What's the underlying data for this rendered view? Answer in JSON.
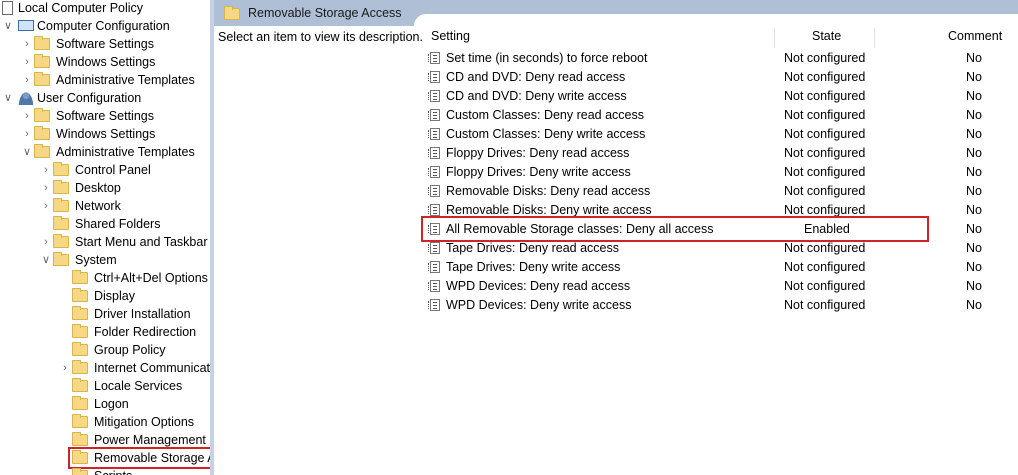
{
  "tree": [
    {
      "label": "Local Computer Policy",
      "chev": "",
      "icon": "policy-computer-icon",
      "level": 0
    },
    {
      "label": "Computer Configuration",
      "chev": "v",
      "icon": "computer-icon",
      "level": 1
    },
    {
      "label": "Software Settings",
      "chev": ">",
      "icon": "folder-icon",
      "level": 2
    },
    {
      "label": "Windows Settings",
      "chev": ">",
      "icon": "folder-icon",
      "level": 2
    },
    {
      "label": "Administrative Templates",
      "chev": ">",
      "icon": "folder-icon",
      "level": 2
    },
    {
      "label": "User Configuration",
      "chev": "v",
      "icon": "user-icon",
      "level": 1
    },
    {
      "label": "Software Settings",
      "chev": ">",
      "icon": "folder-icon",
      "level": 2
    },
    {
      "label": "Windows Settings",
      "chev": ">",
      "icon": "folder-icon",
      "level": 2
    },
    {
      "label": "Administrative Templates",
      "chev": "v",
      "icon": "folder-icon",
      "level": 2
    },
    {
      "label": "Control Panel",
      "chev": ">",
      "icon": "folder-icon",
      "level": 3
    },
    {
      "label": "Desktop",
      "chev": ">",
      "icon": "folder-icon",
      "level": 3
    },
    {
      "label": "Network",
      "chev": ">",
      "icon": "folder-icon",
      "level": 3
    },
    {
      "label": "Shared Folders",
      "chev": "",
      "icon": "folder-icon",
      "level": 3
    },
    {
      "label": "Start Menu and Taskbar",
      "chev": ">",
      "icon": "folder-icon",
      "level": 3
    },
    {
      "label": "System",
      "chev": "v",
      "icon": "folder-icon",
      "level": 3
    },
    {
      "label": "Ctrl+Alt+Del Options",
      "chev": "",
      "icon": "folder-icon",
      "level": 4
    },
    {
      "label": "Display",
      "chev": "",
      "icon": "folder-icon",
      "level": 4
    },
    {
      "label": "Driver Installation",
      "chev": "",
      "icon": "folder-icon",
      "level": 4
    },
    {
      "label": "Folder Redirection",
      "chev": "",
      "icon": "folder-icon",
      "level": 4
    },
    {
      "label": "Group Policy",
      "chev": "",
      "icon": "folder-icon",
      "level": 4
    },
    {
      "label": "Internet Communicati",
      "chev": ">",
      "icon": "folder-icon",
      "level": 4
    },
    {
      "label": "Locale Services",
      "chev": "",
      "icon": "folder-icon",
      "level": 4
    },
    {
      "label": "Logon",
      "chev": "",
      "icon": "folder-icon",
      "level": 4
    },
    {
      "label": "Mitigation Options",
      "chev": "",
      "icon": "folder-icon",
      "level": 4
    },
    {
      "label": "Power Management",
      "chev": "",
      "icon": "folder-icon",
      "level": 4
    },
    {
      "label": "Removable Storage A",
      "chev": "",
      "icon": "folder-icon",
      "level": 4,
      "selected": true
    },
    {
      "label": "Scripts",
      "chev": "",
      "icon": "folder-icon",
      "level": 4
    }
  ],
  "header": {
    "title": "Removable Storage Access"
  },
  "description": "Select an item to view its description.",
  "columns": {
    "setting": "Setting",
    "state": "State",
    "comment": "Comment"
  },
  "policies": [
    {
      "name": "Set time (in seconds) to force reboot",
      "state": "Not configured",
      "comment": "No"
    },
    {
      "name": "CD and DVD: Deny read access",
      "state": "Not configured",
      "comment": "No"
    },
    {
      "name": "CD and DVD: Deny write access",
      "state": "Not configured",
      "comment": "No"
    },
    {
      "name": "Custom Classes: Deny read access",
      "state": "Not configured",
      "comment": "No"
    },
    {
      "name": "Custom Classes: Deny write access",
      "state": "Not configured",
      "comment": "No"
    },
    {
      "name": "Floppy Drives: Deny read access",
      "state": "Not configured",
      "comment": "No"
    },
    {
      "name": "Floppy Drives: Deny write access",
      "state": "Not configured",
      "comment": "No"
    },
    {
      "name": "Removable Disks: Deny read access",
      "state": "Not configured",
      "comment": "No"
    },
    {
      "name": "Removable Disks: Deny write access",
      "state": "Not configured",
      "comment": "No"
    },
    {
      "name": "All Removable Storage classes: Deny all access",
      "state": "Enabled",
      "comment": "No",
      "highlighted": true
    },
    {
      "name": "Tape Drives: Deny read access",
      "state": "Not configured",
      "comment": "No"
    },
    {
      "name": "Tape Drives: Deny write access",
      "state": "Not configured",
      "comment": "No"
    },
    {
      "name": "WPD Devices: Deny read access",
      "state": "Not configured",
      "comment": "No"
    },
    {
      "name": "WPD Devices: Deny write access",
      "state": "Not configured",
      "comment": "No"
    }
  ],
  "colors": {
    "highlight": "#d0222a",
    "header_bar": "#aebfd6",
    "folder": "#f6d884"
  }
}
